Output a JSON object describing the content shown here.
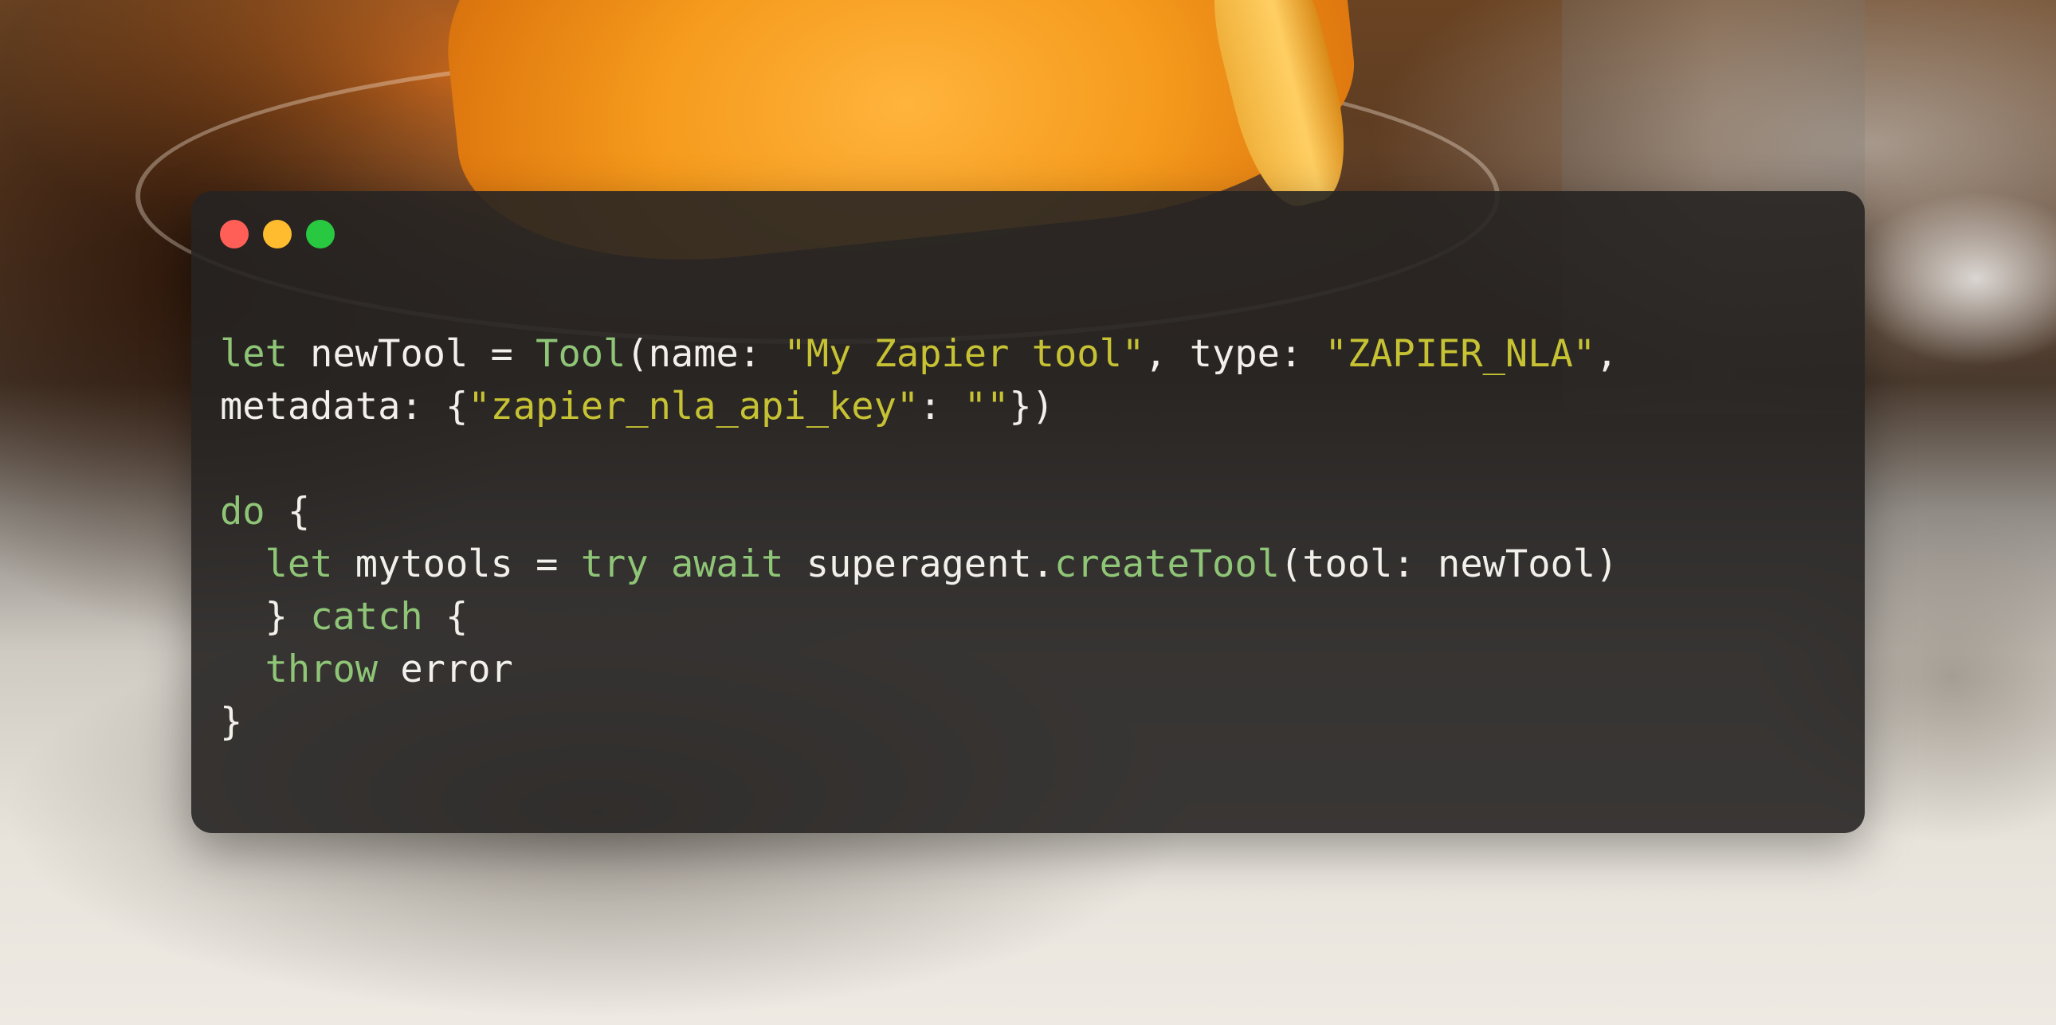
{
  "window": {
    "controls": [
      {
        "name": "close",
        "color": "#ff5f57"
      },
      {
        "name": "minimize",
        "color": "#febc2e"
      },
      {
        "name": "zoom",
        "color": "#28c840"
      }
    ]
  },
  "colors": {
    "keyword": "#8fc576",
    "function": "#8fc576",
    "string": "#c6c233",
    "plain": "#f2f0ea"
  },
  "code": {
    "lines": [
      [
        {
          "t": "let",
          "k": "keyword"
        },
        {
          "t": " newTool = ",
          "k": "plain"
        },
        {
          "t": "Tool",
          "k": "function"
        },
        {
          "t": "(name: ",
          "k": "plain"
        },
        {
          "t": "\"My Zapier tool\"",
          "k": "string"
        },
        {
          "t": ", type: ",
          "k": "plain"
        },
        {
          "t": "\"ZAPIER_NLA\"",
          "k": "string"
        },
        {
          "t": ",",
          "k": "plain"
        }
      ],
      [
        {
          "t": "metadata: {",
          "k": "plain"
        },
        {
          "t": "\"zapier_nla_api_key\"",
          "k": "string"
        },
        {
          "t": ": ",
          "k": "plain"
        },
        {
          "t": "\"\"",
          "k": "string"
        },
        {
          "t": "})",
          "k": "plain"
        }
      ],
      [],
      [
        {
          "t": "do",
          "k": "keyword"
        },
        {
          "t": " {",
          "k": "plain"
        }
      ],
      [
        {
          "t": "  ",
          "k": "plain"
        },
        {
          "t": "let",
          "k": "keyword"
        },
        {
          "t": " mytools = ",
          "k": "plain"
        },
        {
          "t": "try",
          "k": "keyword"
        },
        {
          "t": " ",
          "k": "plain"
        },
        {
          "t": "await",
          "k": "keyword"
        },
        {
          "t": " superagent.",
          "k": "plain"
        },
        {
          "t": "createTool",
          "k": "function"
        },
        {
          "t": "(tool: newTool)",
          "k": "plain"
        }
      ],
      [
        {
          "t": "  } ",
          "k": "plain"
        },
        {
          "t": "catch",
          "k": "keyword"
        },
        {
          "t": " {",
          "k": "plain"
        }
      ],
      [
        {
          "t": "  ",
          "k": "plain"
        },
        {
          "t": "throw",
          "k": "keyword"
        },
        {
          "t": " error",
          "k": "plain"
        }
      ],
      [
        {
          "t": "}",
          "k": "plain"
        }
      ]
    ]
  }
}
